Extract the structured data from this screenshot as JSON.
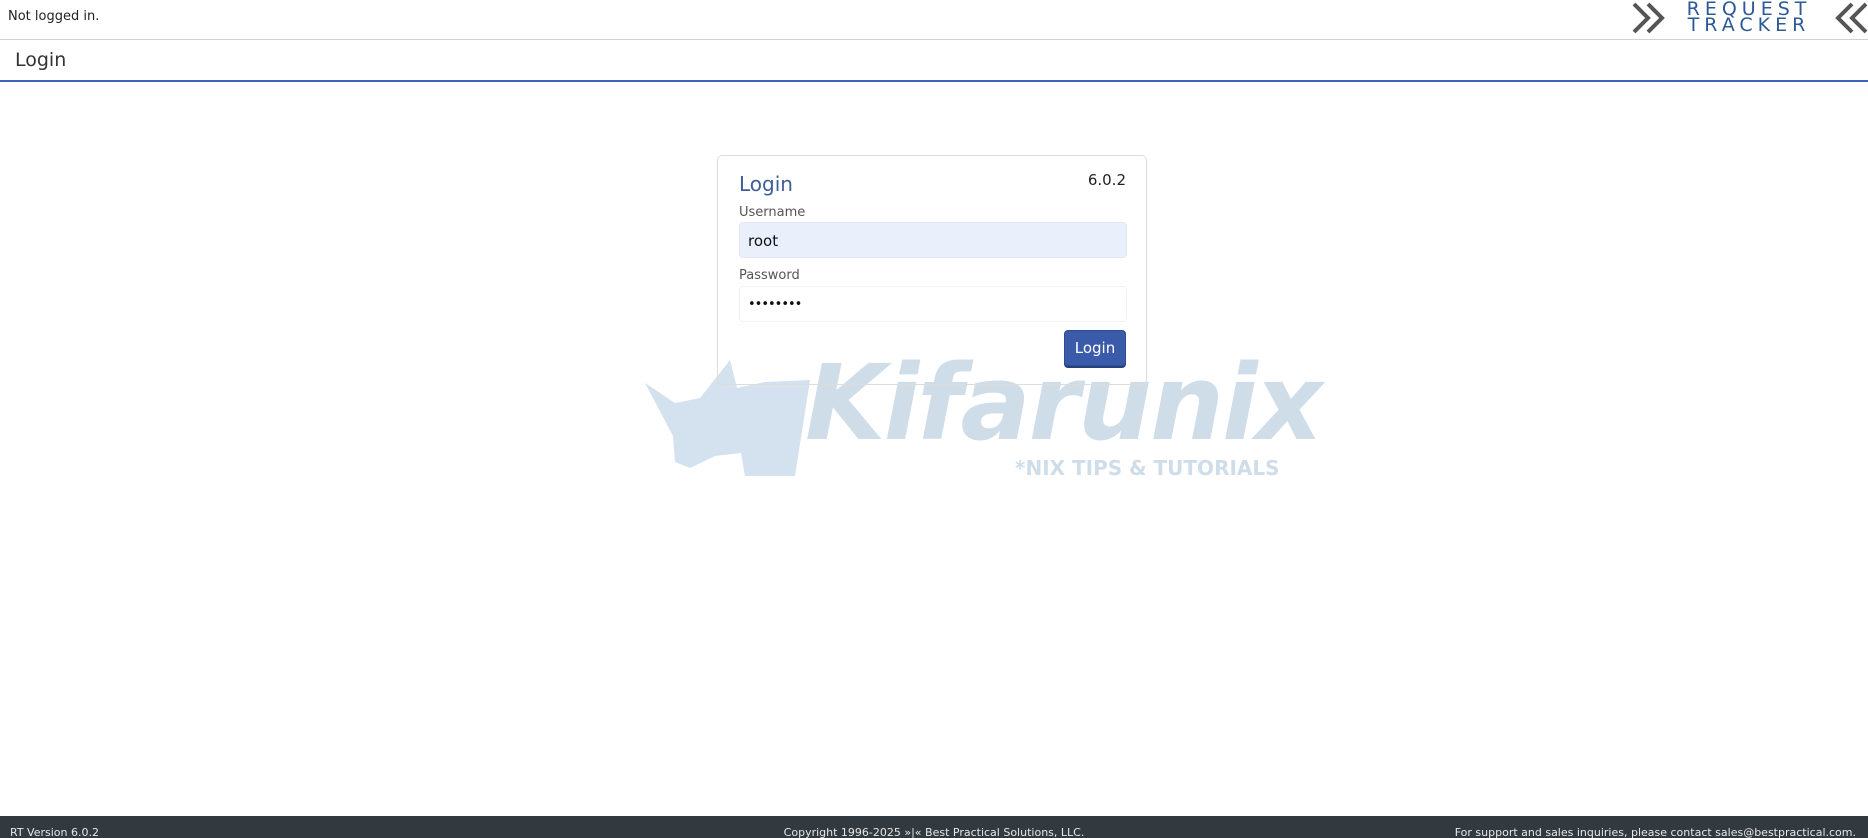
{
  "topbar": {
    "status_text": "Not logged in.",
    "logo": {
      "line1": "REQUEST",
      "line2": "TRACKER",
      "chevron_color": "#555555",
      "text_color": "#2d5a97"
    }
  },
  "page_header": {
    "title": "Login",
    "accent_color": "#3b63b8"
  },
  "login_box": {
    "title": "Login",
    "version": "6.0.2",
    "username": {
      "label": "Username",
      "value": "root"
    },
    "password": {
      "label": "Password",
      "value": "••••••••"
    },
    "submit_label": "Login",
    "button_color": "#3a5ba9"
  },
  "watermark": {
    "brand": "Kifarunix",
    "tagline": "*NIX TIPS & TUTORIALS",
    "color": "#cfdde9"
  },
  "footer": {
    "left": "RT Version 6.0.2",
    "center": "Copyright 1996-2025 »|« Best Practical Solutions, LLC.",
    "right": "For support and sales inquiries, please contact sales@bestpractical.com."
  }
}
